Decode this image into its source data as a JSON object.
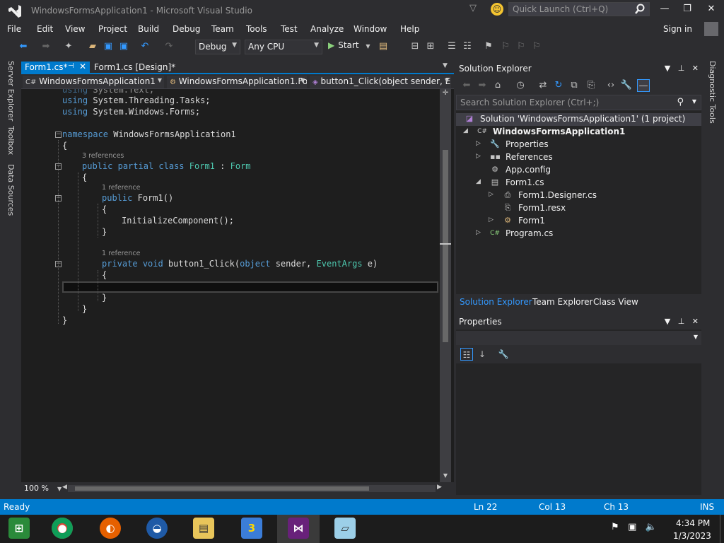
{
  "window": {
    "title": "WindowsFormsApplication1 - Microsoft Visual Studio",
    "quick_launch_placeholder": "Quick Launch (Ctrl+Q)"
  },
  "menu": [
    "File",
    "Edit",
    "View",
    "Project",
    "Build",
    "Debug",
    "Team",
    "Tools",
    "Test",
    "Analyze",
    "Window",
    "Help"
  ],
  "account": {
    "sign_in": "Sign in"
  },
  "toolbar": {
    "configuration": "Debug",
    "platform": "Any CPU",
    "start_label": "Start"
  },
  "left_tool_tabs": [
    "Server Explorer",
    "Toolbox",
    "Data Sources"
  ],
  "right_tool_tabs": [
    "Diagnostic Tools"
  ],
  "doc_tabs": [
    {
      "label": "Form1.cs*",
      "active": true
    },
    {
      "label": "Form1.cs [Design]*",
      "active": false
    }
  ],
  "navbar": {
    "project": "WindowsFormsApplication1",
    "type": "WindowsFormsApplication1.Fo",
    "member": "button1_Click(object sender, E"
  },
  "code": {
    "partial_line": "using System.Text;",
    "lines": [
      "using System.Threading.Tasks;",
      "using System.Windows.Forms;",
      "namespace WindowsFormsApplication1",
      "{",
      "public partial class Form1 : Form",
      "{",
      "public Form1()",
      "{",
      "InitializeComponent();",
      "}",
      "private void button1_Click(object sender, EventArgs e)",
      "{",
      "}",
      "}",
      "}"
    ],
    "refs": [
      "3 references",
      "1 reference",
      "1 reference"
    ],
    "tokens": {
      "using": "using",
      "namespace_kw": "namespace",
      "public": "public",
      "partial": "partial",
      "class": "class",
      "private": "private",
      "void": "void",
      "object": "object",
      "ns_threading": "System.Threading.Tasks;",
      "ns_forms": "System.Windows.Forms;",
      "ns_text": "System.Text;",
      "ns_name": "WindowsFormsApplication1",
      "type_form1": "Form1",
      "colon": ":",
      "type_form": "Form",
      "ctor": "Form1()",
      "init": "InitializeComponent();",
      "method": "button1_Click(",
      "sender": "sender,",
      "eventargs": "EventArgs",
      "e_param": "e)",
      "open_brace": "{",
      "close_brace": "}"
    }
  },
  "editor": {
    "zoom": "100 %"
  },
  "solution_explorer": {
    "title": "Solution Explorer",
    "search_placeholder": "Search Solution Explorer (Ctrl+;)",
    "tree": [
      {
        "label": "Solution 'WindowsFormsApplication1' (1 project)",
        "icon": "solution-icon",
        "depth": 0,
        "expander": "",
        "selected": true
      },
      {
        "label": "WindowsFormsApplication1",
        "icon": "csharp-project-icon",
        "depth": 1,
        "expander": "expanded",
        "bold": true
      },
      {
        "label": "Properties",
        "icon": "wrench-icon",
        "depth": 2,
        "expander": "collapsed"
      },
      {
        "label": "References",
        "icon": "references-icon",
        "depth": 2,
        "expander": "collapsed"
      },
      {
        "label": "App.config",
        "icon": "config-file-icon",
        "depth": 2,
        "expander": ""
      },
      {
        "label": "Form1.cs",
        "icon": "form-icon",
        "depth": 2,
        "expander": "expanded"
      },
      {
        "label": "Form1.Designer.cs",
        "icon": "csharp-file-icon",
        "depth": 3,
        "expander": "collapsed"
      },
      {
        "label": "Form1.resx",
        "icon": "resx-file-icon",
        "depth": 3,
        "expander": ""
      },
      {
        "label": "Form1",
        "icon": "class-icon",
        "depth": 3,
        "expander": "collapsed"
      },
      {
        "label": "Program.cs",
        "icon": "csharp-file-icon",
        "depth": 2,
        "expander": "collapsed"
      }
    ],
    "tabs": [
      {
        "label": "Solution Explorer",
        "active": true
      },
      {
        "label": "Team Explorer",
        "active": false
      },
      {
        "label": "Class View",
        "active": false
      }
    ]
  },
  "properties": {
    "title": "Properties"
  },
  "status": {
    "state": "Ready",
    "ln": "Ln 22",
    "col": "Col 13",
    "ch": "Ch 13",
    "mode": "INS"
  },
  "taskbar": {
    "time": "4:34 PM",
    "date": "1/3/2023",
    "apps": [
      "windows-media-center-icon",
      "chrome-icon",
      "firefox-icon",
      "campaign-logo-icon",
      "file-explorer-icon",
      "app-3-icon",
      "visual-studio-icon",
      "notepad-icon"
    ]
  },
  "colors": {
    "accent": "#007acc",
    "keyword": "#569cd6",
    "type": "#4ec9b0",
    "editor_bg": "#1e1e1e",
    "chrome_bg": "#2d2d30"
  }
}
